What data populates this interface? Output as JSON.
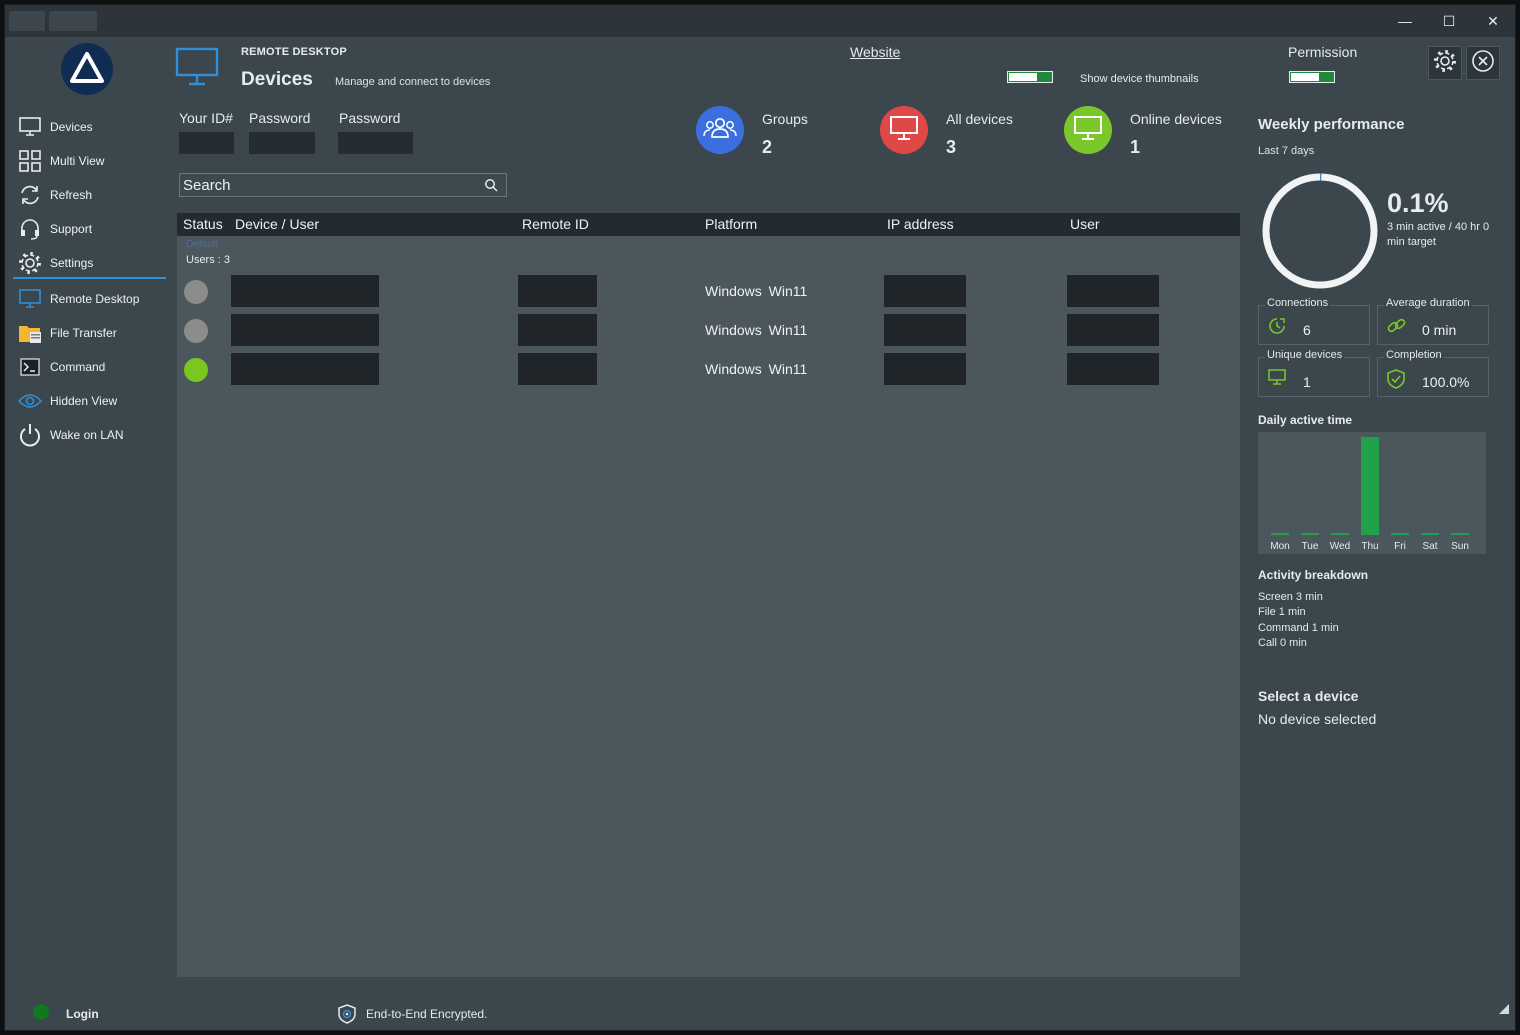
{
  "window": {
    "minimize": "—",
    "maximize": "☐",
    "close": "✕"
  },
  "sidebar": {
    "items": [
      {
        "label": "Devices",
        "icon": "monitor-icon"
      },
      {
        "label": "Multi View",
        "icon": "grid-icon"
      },
      {
        "label": "Refresh",
        "icon": "refresh-icon"
      },
      {
        "label": "Support",
        "icon": "headset-icon"
      },
      {
        "label": "Settings",
        "icon": "gear-icon"
      },
      {
        "label": "Remote Desktop",
        "icon": "monitor-icon"
      },
      {
        "label": "File Transfer",
        "icon": "folder-icon"
      },
      {
        "label": "Command",
        "icon": "terminal-icon"
      },
      {
        "label": "Hidden View",
        "icon": "eye-icon"
      },
      {
        "label": "Wake on LAN",
        "icon": "power-icon"
      }
    ]
  },
  "header": {
    "tag": "REMOTE DESKTOP",
    "title": "Devices",
    "subtitle": "Manage and connect to devices",
    "website_link": "Website",
    "thumbnails_label": "Show device thumbnails",
    "permission_label": "Permission"
  },
  "credentials": {
    "your_id_label": "Your ID#",
    "password_label_1": "Password",
    "password_label_2": "Password"
  },
  "search": {
    "placeholder": "Search"
  },
  "stats": {
    "groups": {
      "label": "Groups",
      "value": "2",
      "color": "#3b6fe0"
    },
    "all_devices": {
      "label": "All devices",
      "value": "3",
      "color": "#e04848"
    },
    "online_devices": {
      "label": "Online devices",
      "value": "1",
      "color": "#7bc62a"
    }
  },
  "table": {
    "headers": [
      "Status",
      "Device / User",
      "Remote ID",
      "Platform",
      "IP address",
      "User"
    ],
    "group_name": "Default",
    "group_count": "Users : 3",
    "rows": [
      {
        "status": "offline",
        "status_color": "#8c8c8c",
        "platform": "Windows Win11"
      },
      {
        "status": "offline",
        "status_color": "#8c8c8c",
        "platform": "Windows Win11"
      },
      {
        "status": "online",
        "status_color": "#79c71f",
        "platform": "Windows Win11"
      }
    ]
  },
  "performance": {
    "title": "Weekly performance",
    "period": "Last 7 days",
    "percent_text": "0.1%",
    "percent_value": 0.1,
    "summary": "3 min active / 40 hr 0 min target",
    "metrics": {
      "connections": {
        "label": "Connections",
        "value": "6"
      },
      "avg_duration": {
        "label": "Average duration",
        "value": "0 min"
      },
      "unique_devices": {
        "label": "Unique devices",
        "value": "1"
      },
      "completion": {
        "label": "Completion",
        "value": "100.0%"
      }
    }
  },
  "daily_active": {
    "title": "Daily active time",
    "days": [
      "Mon",
      "Tue",
      "Wed",
      "Thu",
      "Fri",
      "Sat",
      "Sun"
    ],
    "values": [
      0,
      0,
      0,
      3,
      0,
      0,
      0
    ],
    "bar_color": "#1fa24a"
  },
  "activity": {
    "title": "Activity breakdown",
    "items": [
      "Screen  3 min",
      "File  1 min",
      "Command  1 min",
      "Call  0 min"
    ]
  },
  "selection": {
    "title": "Select a device",
    "status": "No device selected"
  },
  "footer": {
    "login_label": "Login",
    "encryption_label": "End-to-End Encrypted."
  }
}
